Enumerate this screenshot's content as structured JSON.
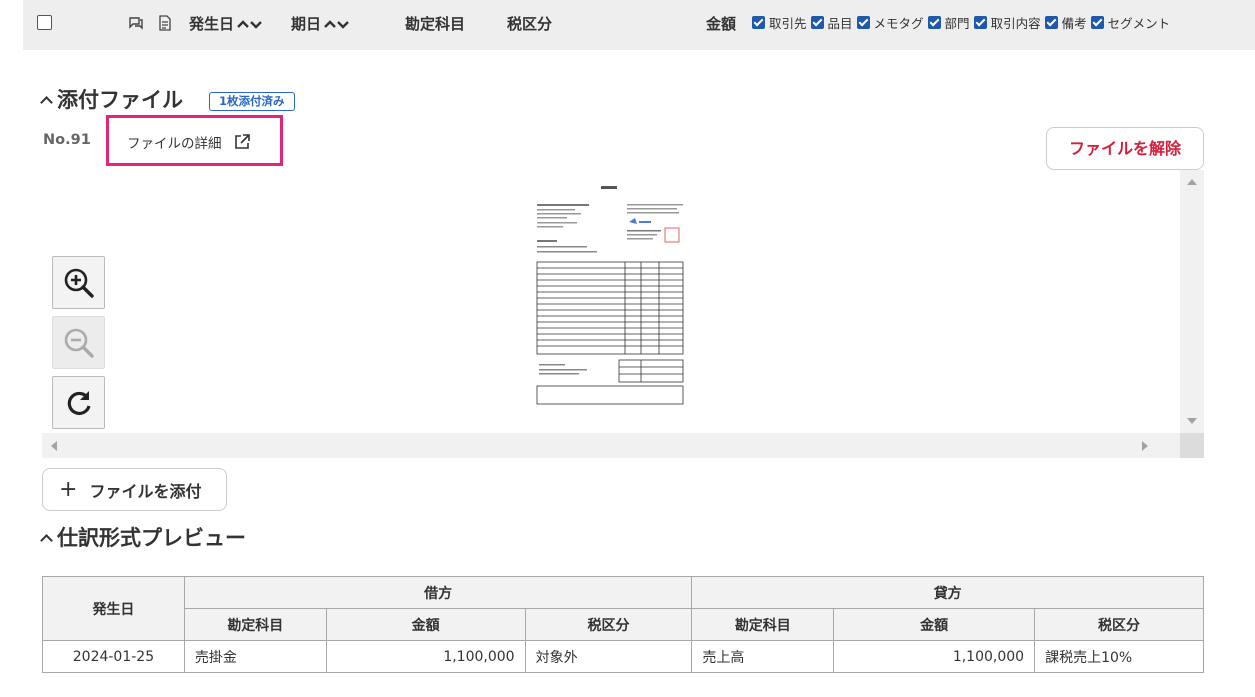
{
  "header": {
    "columns": {
      "occur_date": "発生日",
      "due_date": "期日",
      "account": "勘定科目",
      "tax": "税区分",
      "amount": "金額"
    },
    "options": [
      {
        "label": "取引先",
        "checked": true
      },
      {
        "label": "品目",
        "checked": true
      },
      {
        "label": "メモタグ",
        "checked": true
      },
      {
        "label": "部門",
        "checked": true
      },
      {
        "label": "取引内容",
        "checked": true
      },
      {
        "label": "備考",
        "checked": true
      },
      {
        "label": "セグメント",
        "checked": true
      }
    ]
  },
  "attachments": {
    "title": "添付ファイル",
    "badge": "1枚添付済み",
    "file_no": "No.91",
    "detail_link": "ファイルの詳細",
    "detach_button": "ファイルを解除",
    "attach_button": "ファイルを添付",
    "attach_icon": "plus-icon"
  },
  "preview_controls": {
    "zoom_in": "zoom-in-icon",
    "zoom_out": "zoom-out-icon",
    "rotate": "rotate-icon"
  },
  "journal": {
    "title": "仕訳形式プレビュー",
    "date_header": "発生日",
    "debit_header": "借方",
    "credit_header": "貸方",
    "sub_headers": [
      "勘定科目",
      "金額",
      "税区分",
      "勘定科目",
      "金額",
      "税区分"
    ],
    "rows": [
      {
        "date": "2024-01-25",
        "debit_account": "売掛金",
        "debit_amount": "1,100,000",
        "debit_tax": "対象外",
        "credit_account": "売上高",
        "credit_amount": "1,100,000",
        "credit_tax": "課税売上10%"
      }
    ]
  },
  "colors": {
    "accent_blue": "#2a66c8",
    "danger_red": "#d81e3a",
    "highlight_pink": "#e2247a"
  }
}
